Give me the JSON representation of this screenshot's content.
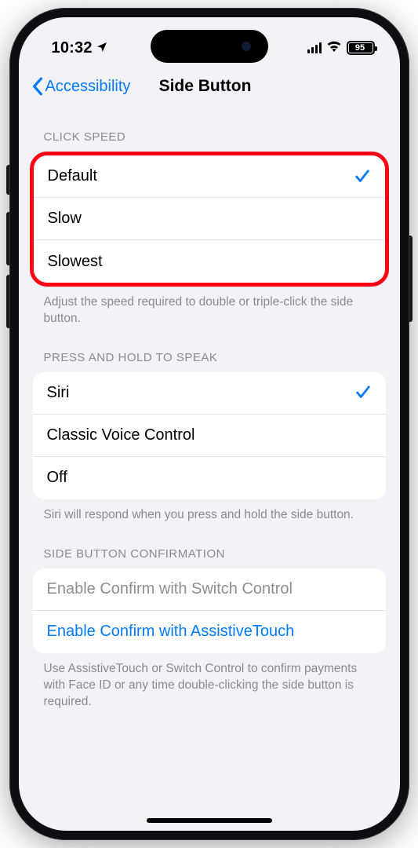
{
  "status": {
    "time": "10:32",
    "battery": "95"
  },
  "nav": {
    "back_label": "Accessibility",
    "title": "Side Button"
  },
  "sections": {
    "click_speed": {
      "header": "CLICK SPEED",
      "options": [
        {
          "label": "Default",
          "selected": true
        },
        {
          "label": "Slow",
          "selected": false
        },
        {
          "label": "Slowest",
          "selected": false
        }
      ],
      "footer": "Adjust the speed required to double or triple-click the side button."
    },
    "press_hold": {
      "header": "PRESS AND HOLD TO SPEAK",
      "options": [
        {
          "label": "Siri",
          "selected": true
        },
        {
          "label": "Classic Voice Control",
          "selected": false
        },
        {
          "label": "Off",
          "selected": false
        }
      ],
      "footer": "Siri will respond when you press and hold the side button."
    },
    "confirmation": {
      "header": "SIDE BUTTON CONFIRMATION",
      "items": [
        {
          "label": "Enable Confirm with Switch Control",
          "disabled": true
        },
        {
          "label": "Enable Confirm with AssistiveTouch",
          "disabled": false
        }
      ],
      "footer": "Use AssistiveTouch or Switch Control to confirm payments with Face ID or any time double-clicking the side button is required."
    }
  }
}
